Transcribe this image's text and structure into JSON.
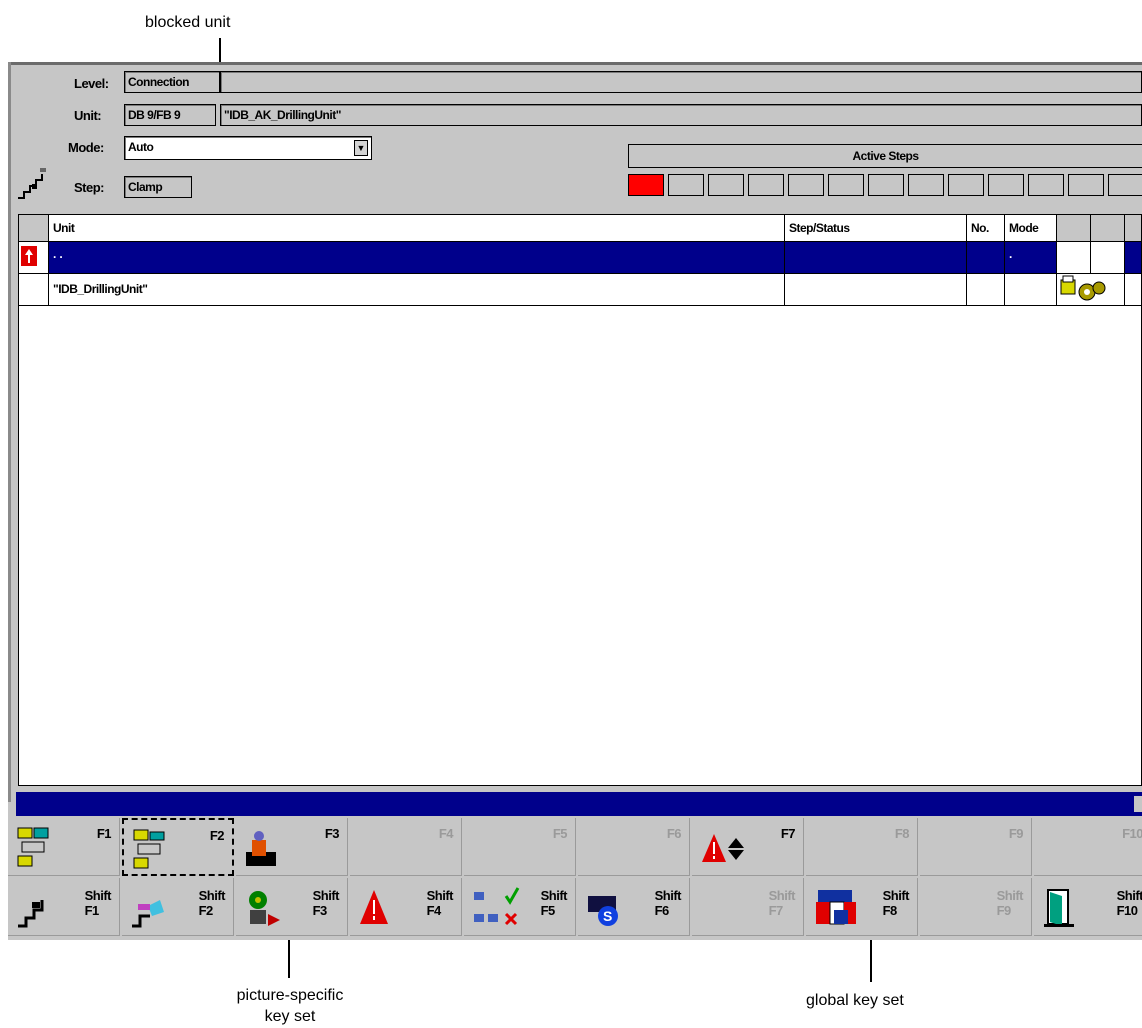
{
  "callouts": {
    "blocked_unit": "blocked unit",
    "picture_specific": "picture-specific\nkey set",
    "global": "global key set"
  },
  "header": {
    "level_label": "Level:",
    "level_value": "Connection",
    "unit_label": "Unit:",
    "unit_db": "DB 9/FB 9",
    "unit_name": "\"IDB_AK_DrillingUnit\"",
    "mode_label": "Mode:",
    "mode_value": "Auto",
    "step_label": "Step:",
    "step_value": "Clamp",
    "active_steps_title": "Active Steps",
    "active_step_count_active": 1
  },
  "table": {
    "columns": [
      "Unit",
      "Step/Status",
      "No.",
      "Mode"
    ],
    "rows": [
      {
        "unit": "· ·",
        "step": "",
        "no": "",
        "mode": "·",
        "blocked": true,
        "selected": true
      },
      {
        "unit": "\"IDB_DrillingUnit\"",
        "step": "",
        "no": "",
        "mode": "",
        "blocked": false,
        "selected": false
      }
    ]
  },
  "status_bar": {
    "text": ""
  },
  "keys_top": [
    {
      "label": "F1",
      "icon": "unit-overview-icon",
      "enabled": true
    },
    {
      "label": "F2",
      "icon": "unit-select-icon",
      "enabled": true
    },
    {
      "label": "F3",
      "icon": "operator-icon",
      "enabled": true
    },
    {
      "label": "F4",
      "icon": "",
      "enabled": false
    },
    {
      "label": "F5",
      "icon": "",
      "enabled": false
    },
    {
      "label": "F6",
      "icon": "",
      "enabled": false
    },
    {
      "label": "F7",
      "icon": "alarm-updown-icon",
      "enabled": true
    },
    {
      "label": "F8",
      "icon": "",
      "enabled": false
    },
    {
      "label": "F9",
      "icon": "",
      "enabled": false
    },
    {
      "label": "F10",
      "icon": "",
      "enabled": false
    }
  ],
  "keys_bottom": [
    {
      "label": "Shift\nF1",
      "icon": "step-icon",
      "enabled": true
    },
    {
      "label": "Shift\nF2",
      "icon": "motion-icon",
      "enabled": true
    },
    {
      "label": "Shift\nF3",
      "icon": "actuator-icon",
      "enabled": true
    },
    {
      "label": "Shift\nF4",
      "icon": "alarm-icon",
      "enabled": true
    },
    {
      "label": "Shift\nF5",
      "icon": "network-check-icon",
      "enabled": true
    },
    {
      "label": "Shift\nF6",
      "icon": "s-monitor-icon",
      "enabled": true
    },
    {
      "label": "Shift\nF7",
      "icon": "",
      "enabled": false
    },
    {
      "label": "Shift\nF8",
      "icon": "language-flag-icon",
      "enabled": true
    },
    {
      "label": "Shift\nF9",
      "icon": "",
      "enabled": false
    },
    {
      "label": "Shift\nF10",
      "icon": "exit-door-icon",
      "enabled": true
    }
  ]
}
